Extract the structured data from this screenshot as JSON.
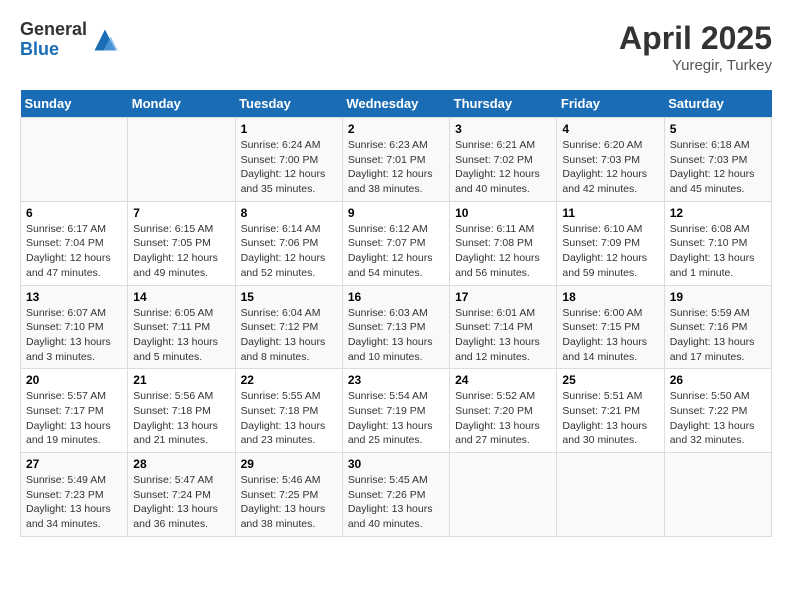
{
  "header": {
    "logo_general": "General",
    "logo_blue": "Blue",
    "month_title": "April 2025",
    "location": "Yuregir, Turkey"
  },
  "days_of_week": [
    "Sunday",
    "Monday",
    "Tuesday",
    "Wednesday",
    "Thursday",
    "Friday",
    "Saturday"
  ],
  "weeks": [
    [
      {
        "day": "",
        "info": ""
      },
      {
        "day": "",
        "info": ""
      },
      {
        "day": "1",
        "info": "Sunrise: 6:24 AM\nSunset: 7:00 PM\nDaylight: 12 hours and 35 minutes."
      },
      {
        "day": "2",
        "info": "Sunrise: 6:23 AM\nSunset: 7:01 PM\nDaylight: 12 hours and 38 minutes."
      },
      {
        "day": "3",
        "info": "Sunrise: 6:21 AM\nSunset: 7:02 PM\nDaylight: 12 hours and 40 minutes."
      },
      {
        "day": "4",
        "info": "Sunrise: 6:20 AM\nSunset: 7:03 PM\nDaylight: 12 hours and 42 minutes."
      },
      {
        "day": "5",
        "info": "Sunrise: 6:18 AM\nSunset: 7:03 PM\nDaylight: 12 hours and 45 minutes."
      }
    ],
    [
      {
        "day": "6",
        "info": "Sunrise: 6:17 AM\nSunset: 7:04 PM\nDaylight: 12 hours and 47 minutes."
      },
      {
        "day": "7",
        "info": "Sunrise: 6:15 AM\nSunset: 7:05 PM\nDaylight: 12 hours and 49 minutes."
      },
      {
        "day": "8",
        "info": "Sunrise: 6:14 AM\nSunset: 7:06 PM\nDaylight: 12 hours and 52 minutes."
      },
      {
        "day": "9",
        "info": "Sunrise: 6:12 AM\nSunset: 7:07 PM\nDaylight: 12 hours and 54 minutes."
      },
      {
        "day": "10",
        "info": "Sunrise: 6:11 AM\nSunset: 7:08 PM\nDaylight: 12 hours and 56 minutes."
      },
      {
        "day": "11",
        "info": "Sunrise: 6:10 AM\nSunset: 7:09 PM\nDaylight: 12 hours and 59 minutes."
      },
      {
        "day": "12",
        "info": "Sunrise: 6:08 AM\nSunset: 7:10 PM\nDaylight: 13 hours and 1 minute."
      }
    ],
    [
      {
        "day": "13",
        "info": "Sunrise: 6:07 AM\nSunset: 7:10 PM\nDaylight: 13 hours and 3 minutes."
      },
      {
        "day": "14",
        "info": "Sunrise: 6:05 AM\nSunset: 7:11 PM\nDaylight: 13 hours and 5 minutes."
      },
      {
        "day": "15",
        "info": "Sunrise: 6:04 AM\nSunset: 7:12 PM\nDaylight: 13 hours and 8 minutes."
      },
      {
        "day": "16",
        "info": "Sunrise: 6:03 AM\nSunset: 7:13 PM\nDaylight: 13 hours and 10 minutes."
      },
      {
        "day": "17",
        "info": "Sunrise: 6:01 AM\nSunset: 7:14 PM\nDaylight: 13 hours and 12 minutes."
      },
      {
        "day": "18",
        "info": "Sunrise: 6:00 AM\nSunset: 7:15 PM\nDaylight: 13 hours and 14 minutes."
      },
      {
        "day": "19",
        "info": "Sunrise: 5:59 AM\nSunset: 7:16 PM\nDaylight: 13 hours and 17 minutes."
      }
    ],
    [
      {
        "day": "20",
        "info": "Sunrise: 5:57 AM\nSunset: 7:17 PM\nDaylight: 13 hours and 19 minutes."
      },
      {
        "day": "21",
        "info": "Sunrise: 5:56 AM\nSunset: 7:18 PM\nDaylight: 13 hours and 21 minutes."
      },
      {
        "day": "22",
        "info": "Sunrise: 5:55 AM\nSunset: 7:18 PM\nDaylight: 13 hours and 23 minutes."
      },
      {
        "day": "23",
        "info": "Sunrise: 5:54 AM\nSunset: 7:19 PM\nDaylight: 13 hours and 25 minutes."
      },
      {
        "day": "24",
        "info": "Sunrise: 5:52 AM\nSunset: 7:20 PM\nDaylight: 13 hours and 27 minutes."
      },
      {
        "day": "25",
        "info": "Sunrise: 5:51 AM\nSunset: 7:21 PM\nDaylight: 13 hours and 30 minutes."
      },
      {
        "day": "26",
        "info": "Sunrise: 5:50 AM\nSunset: 7:22 PM\nDaylight: 13 hours and 32 minutes."
      }
    ],
    [
      {
        "day": "27",
        "info": "Sunrise: 5:49 AM\nSunset: 7:23 PM\nDaylight: 13 hours and 34 minutes."
      },
      {
        "day": "28",
        "info": "Sunrise: 5:47 AM\nSunset: 7:24 PM\nDaylight: 13 hours and 36 minutes."
      },
      {
        "day": "29",
        "info": "Sunrise: 5:46 AM\nSunset: 7:25 PM\nDaylight: 13 hours and 38 minutes."
      },
      {
        "day": "30",
        "info": "Sunrise: 5:45 AM\nSunset: 7:26 PM\nDaylight: 13 hours and 40 minutes."
      },
      {
        "day": "",
        "info": ""
      },
      {
        "day": "",
        "info": ""
      },
      {
        "day": "",
        "info": ""
      }
    ]
  ]
}
